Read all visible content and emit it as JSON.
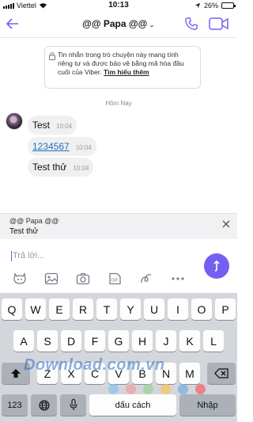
{
  "status_bar": {
    "carrier": "Viettel",
    "time": "10:13",
    "battery_percent": "26%",
    "battery_level": 0.26
  },
  "header": {
    "title": "@@ Papa @@",
    "chevron": "⌄"
  },
  "notice": {
    "text": "Tin nhắn trong trò chuyện này mang tính riêng tư và được bảo vệ bằng mã hóa đầu cuối của Viber.",
    "link_label": "Tìm hiểu thêm"
  },
  "date_separator": "Hôm Nay",
  "messages": [
    {
      "text": "Test",
      "time": "10:04"
    },
    {
      "text": "1234567",
      "time": "10:04"
    },
    {
      "text": "Test thử",
      "time": "10:04"
    }
  ],
  "reply_preview": {
    "name": "@@ Papa @@",
    "text": "Test thử"
  },
  "composer": {
    "placeholder": "Trả lời...",
    "value": ""
  },
  "toolbar_icons": [
    "sticker-icon",
    "gallery-icon",
    "camera-icon",
    "gif-icon",
    "doodle-icon",
    "more-icon"
  ],
  "keyboard": {
    "row1": [
      "Q",
      "W",
      "E",
      "R",
      "T",
      "Y",
      "U",
      "I",
      "O",
      "P"
    ],
    "row2": [
      "A",
      "S",
      "D",
      "F",
      "G",
      "H",
      "J",
      "K",
      "L"
    ],
    "row3": [
      "Z",
      "X",
      "C",
      "V",
      "B",
      "N",
      "M"
    ],
    "numbers_label": "123",
    "space_label": "dấu cách",
    "return_label": "Nhập"
  },
  "watermark": "Download.com.vn",
  "colors": {
    "accent": "#7360f2",
    "link": "#1f6fc1",
    "bubble": "#f0f0f0",
    "keyboard": "#d3d6db"
  }
}
